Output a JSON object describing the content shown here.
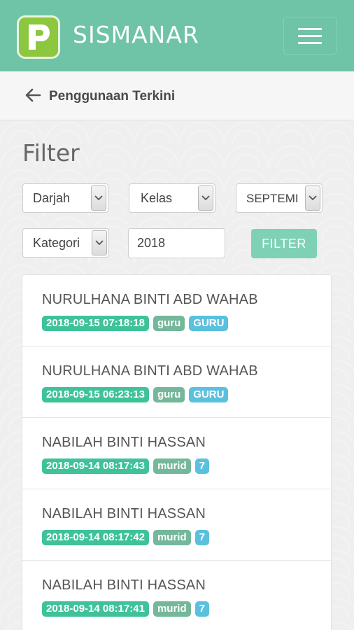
{
  "header": {
    "app_title": "SISMANAR",
    "logo_icon": "p-logo-icon",
    "menu_icon": "hamburger-menu-icon",
    "brand_color": "#6fc3a6"
  },
  "subheader": {
    "back_icon": "arrow-left-icon",
    "title": "Penggunaan Terkini"
  },
  "filter": {
    "title": "Filter",
    "darjah": "Darjah",
    "kelas": "Kelas",
    "bulan": "SEPTEMI",
    "kategori": "Kategori",
    "tahun": "2018",
    "button_label": "FILTER"
  },
  "list": {
    "items": [
      {
        "name": "NURULHANA BINTI ABD WAHAB",
        "datetime": "2018-09-15 07:18:18",
        "role": "guru",
        "kelas": "GURU"
      },
      {
        "name": "NURULHANA BINTI ABD WAHAB",
        "datetime": "2018-09-15 06:23:13",
        "role": "guru",
        "kelas": "GURU"
      },
      {
        "name": "NABILAH BINTI HASSAN",
        "datetime": "2018-09-14 08:17:43",
        "role": "murid",
        "kelas": "7"
      },
      {
        "name": "NABILAH BINTI HASSAN",
        "datetime": "2018-09-14 08:17:42",
        "role": "murid",
        "kelas": "7"
      },
      {
        "name": "NABILAH BINTI HASSAN",
        "datetime": "2018-09-14 08:17:41",
        "role": "murid",
        "kelas": "7"
      }
    ]
  },
  "colors": {
    "date_badge": "#3fc29a",
    "role_badge": "#74b79a",
    "kelas_badge": "#5bc0de",
    "filter_button": "#7fd1b5"
  }
}
